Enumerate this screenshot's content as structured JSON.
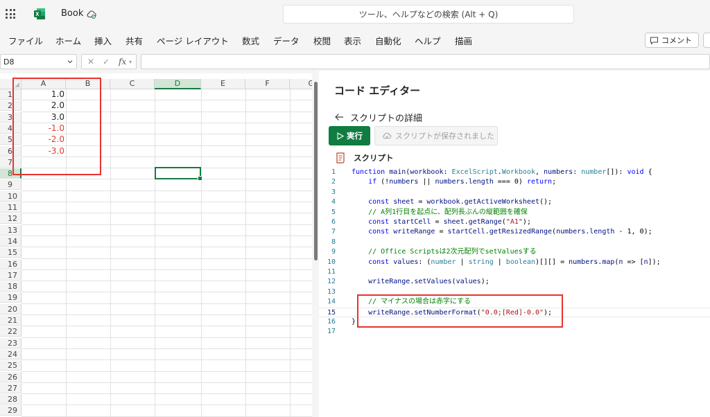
{
  "app": {
    "doc_title": "Book",
    "search_placeholder": "ツール、ヘルプなどの検索 (Alt + Q)"
  },
  "ribbon": {
    "tabs": [
      "ファイル",
      "ホーム",
      "挿入",
      "共有",
      "ページ レイアウト",
      "数式",
      "データ",
      "校閲",
      "表示",
      "自動化",
      "ヘルプ",
      "描画"
    ],
    "comment_label": "コメント"
  },
  "formula_bar": {
    "name_box": "D8",
    "fx_label": "fx",
    "value": ""
  },
  "sheet": {
    "columns": [
      "A",
      "B",
      "C",
      "D",
      "E",
      "F",
      "G"
    ],
    "selected_column": "D",
    "selected_row": "8",
    "rows": [
      "1",
      "2",
      "3",
      "4",
      "5",
      "6",
      "7",
      "8",
      "9",
      "10",
      "11",
      "12",
      "13",
      "14",
      "15",
      "16",
      "17",
      "18",
      "19",
      "20",
      "21",
      "22",
      "23",
      "24",
      "25",
      "26",
      "27",
      "28",
      "29"
    ],
    "cells_a": [
      {
        "row": "1",
        "value": "1.0",
        "negative": false
      },
      {
        "row": "2",
        "value": "2.0",
        "negative": false
      },
      {
        "row": "3",
        "value": "3.0",
        "negative": false
      },
      {
        "row": "4",
        "value": "-1.0",
        "negative": true
      },
      {
        "row": "5",
        "value": "-2.0",
        "negative": true
      },
      {
        "row": "6",
        "value": "-3.0",
        "negative": true
      }
    ],
    "negative_color": "#e03c31",
    "accent_color": "#107c41"
  },
  "editor": {
    "title": "コード エディター",
    "details_label": "スクリプトの詳細",
    "run_label": "実行",
    "saved_label": "スクリプトが保存されました",
    "script_label": "スクリプト",
    "code_lines": [
      "function main(workbook: ExcelScript.Workbook, numbers: number[]): void {",
      "    if (!numbers || numbers.length === 0) return;",
      "",
      "    const sheet = workbook.getActiveWorksheet();",
      "    // A列1行目を起点に、配列長ぶんの縦範囲を確保",
      "    const startCell = sheet.getRange(\"A1\");",
      "    const writeRange = startCell.getResizedRange(numbers.length - 1, 0);",
      "",
      "    // Office Scriptsは2次元配列でsetValuesする",
      "    const values: (number | string | boolean)[][] = numbers.map(n => [n]);",
      "",
      "    writeRange.setValues(values);",
      "",
      "    // マイナスの場合は赤字にする",
      "    writeRange.setNumberFormat(\"0.0;[Red]-0.0\");",
      "}",
      ""
    ],
    "current_line": 15
  }
}
